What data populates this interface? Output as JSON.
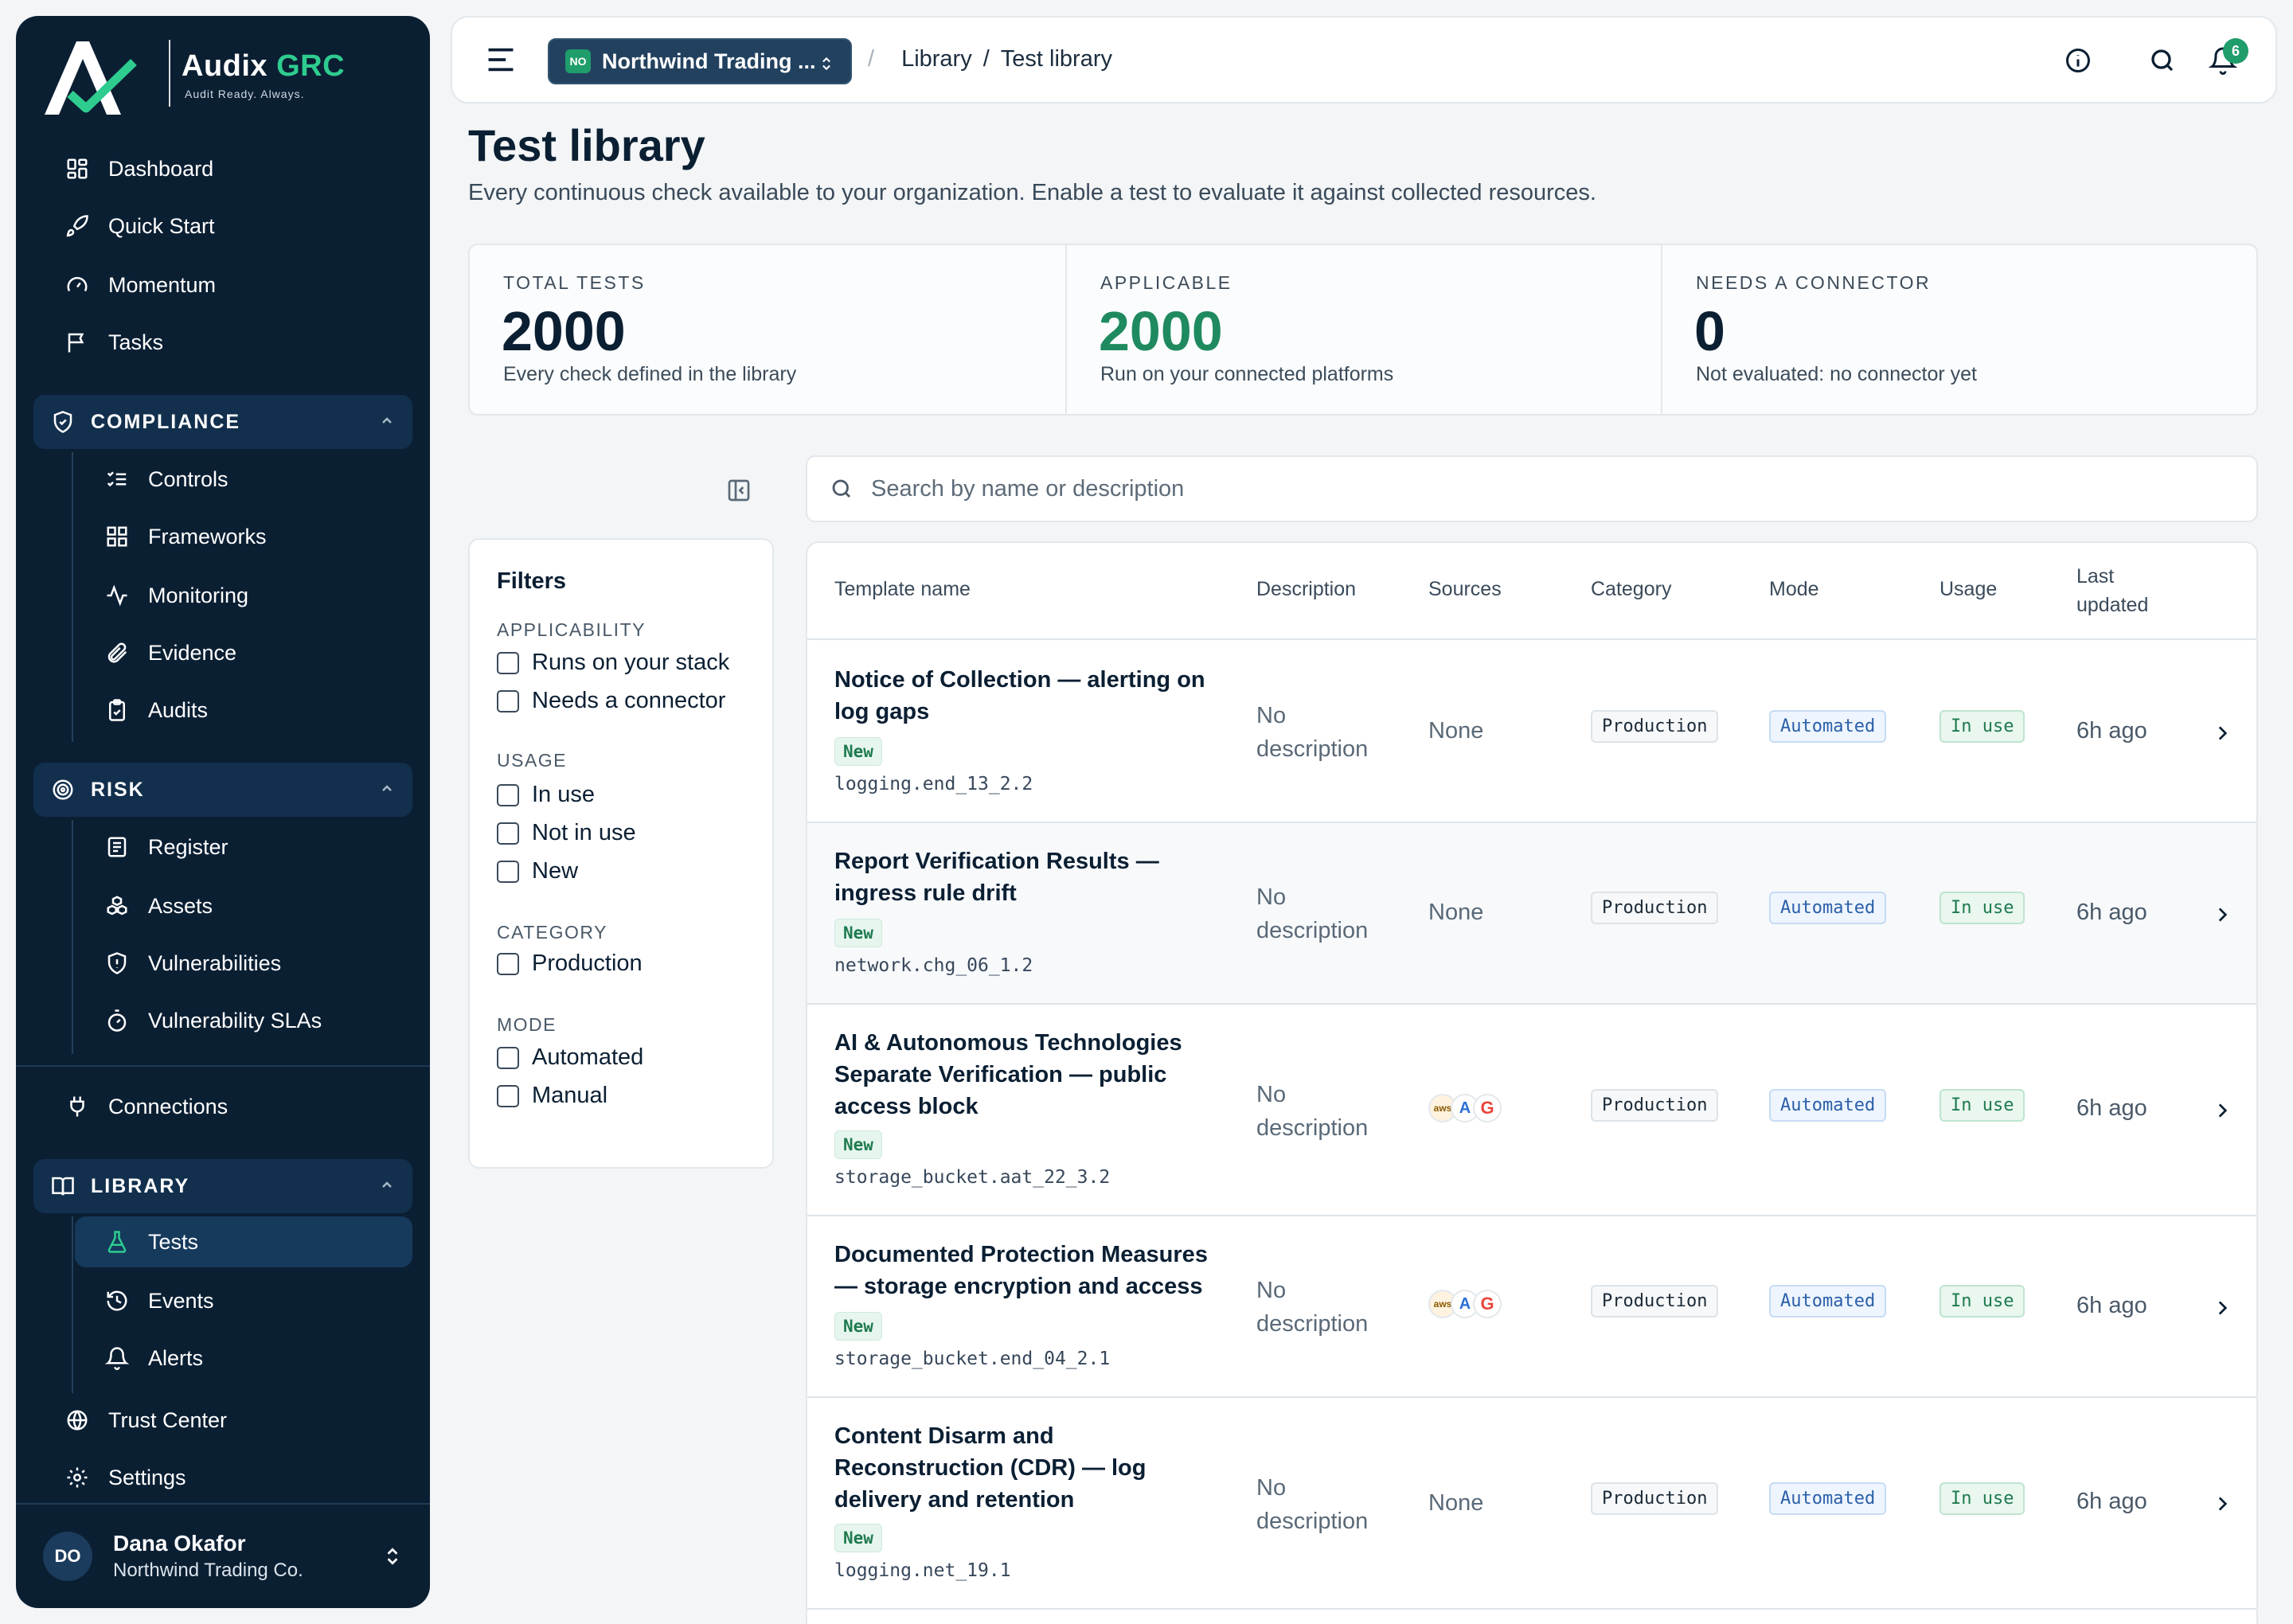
{
  "brand": {
    "name_main": "Audix",
    "name_accent": "GRC",
    "tagline": "Audit Ready. Always."
  },
  "sidebar": {
    "top_items": [
      {
        "label": "Dashboard",
        "icon": "dashboard-icon"
      },
      {
        "label": "Quick Start",
        "icon": "rocket-icon"
      },
      {
        "label": "Momentum",
        "icon": "gauge-icon"
      },
      {
        "label": "Tasks",
        "icon": "flag-icon"
      }
    ],
    "compliance": {
      "label": "COMPLIANCE",
      "items": [
        {
          "label": "Controls",
          "icon": "list-check-icon"
        },
        {
          "label": "Frameworks",
          "icon": "grid-icon"
        },
        {
          "label": "Monitoring",
          "icon": "activity-icon"
        },
        {
          "label": "Evidence",
          "icon": "paperclip-icon"
        },
        {
          "label": "Audits",
          "icon": "clipboard-icon"
        }
      ]
    },
    "risk": {
      "label": "RISK",
      "items": [
        {
          "label": "Register",
          "icon": "register-icon"
        },
        {
          "label": "Assets",
          "icon": "boxes-icon"
        },
        {
          "label": "Vulnerabilities",
          "icon": "shield-alert-icon"
        },
        {
          "label": "Vulnerability SLAs",
          "icon": "timer-icon"
        }
      ]
    },
    "connections": {
      "label": "Connections",
      "icon": "plug-icon"
    },
    "library": {
      "label": "LIBRARY",
      "items": [
        {
          "label": "Tests",
          "icon": "flask-icon",
          "active": true
        },
        {
          "label": "Events",
          "icon": "history-icon"
        },
        {
          "label": "Alerts",
          "icon": "bell-icon"
        }
      ]
    },
    "bottom_items": [
      {
        "label": "Trust Center",
        "icon": "globe-icon"
      },
      {
        "label": "Settings",
        "icon": "gear-icon"
      }
    ],
    "user": {
      "initials": "DO",
      "name": "Dana Okafor",
      "org": "Northwind Trading Co."
    }
  },
  "topbar": {
    "org_badge": "NO",
    "org_name": "Northwind Trading ...",
    "breadcrumb": [
      "Library",
      "Test library"
    ],
    "notification_count": "6"
  },
  "page": {
    "title": "Test library",
    "subtitle": "Every continuous check available to your organization. Enable a test to evaluate it against collected resources."
  },
  "stats": [
    {
      "label": "TOTAL TESTS",
      "value": "2000",
      "desc": "Every check defined in the library"
    },
    {
      "label": "APPLICABLE",
      "value": "2000",
      "desc": "Run on your connected platforms"
    },
    {
      "label": "NEEDS A CONNECTOR",
      "value": "0",
      "desc": "Not evaluated: no connector yet"
    }
  ],
  "filters": {
    "title": "Filters",
    "groups": [
      {
        "label": "APPLICABILITY",
        "options": [
          "Runs on your stack",
          "Needs a connector"
        ]
      },
      {
        "label": "USAGE",
        "options": [
          "In use",
          "Not in use",
          "New"
        ]
      },
      {
        "label": "CATEGORY",
        "options": [
          "Production"
        ]
      },
      {
        "label": "MODE",
        "options": [
          "Automated",
          "Manual"
        ]
      }
    ]
  },
  "search": {
    "placeholder": "Search by name or description",
    "value": ""
  },
  "table": {
    "headers": {
      "name": "Template name",
      "description": "Description",
      "sources": "Sources",
      "category": "Category",
      "mode": "Mode",
      "usage": "Usage",
      "updated_1": "Last",
      "updated_2": "updated"
    },
    "rows": [
      {
        "name": "Notice of Collection — alerting on log gaps",
        "badge": "New",
        "id": "logging.end_13_2.2",
        "desc_1": "No",
        "desc_2": "description",
        "sources": "None",
        "category": "Production",
        "mode": "Automated",
        "usage": "In use",
        "updated": "6h ago"
      },
      {
        "name": "Report Verification Results — ingress rule drift",
        "badge": "New",
        "id": "network.chg_06_1.2",
        "desc_1": "No",
        "desc_2": "description",
        "sources": "None",
        "category": "Production",
        "mode": "Automated",
        "usage": "In use",
        "updated": "6h ago"
      },
      {
        "name": "AI & Autonomous Technologies Separate Verification — public access block",
        "badge": "New",
        "id": "storage_bucket.aat_22_3.2",
        "desc_1": "No",
        "desc_2": "description",
        "sources": "",
        "source_icons": [
          "aws-icon",
          "azure-icon",
          "gcp-icon"
        ],
        "source_labels": [
          "aws",
          "A",
          "G"
        ],
        "category": "Production",
        "mode": "Automated",
        "usage": "In use",
        "updated": "6h ago"
      },
      {
        "name": "Documented Protection Measures — storage encryption and access",
        "badge": "New",
        "id": "storage_bucket.end_04_2.1",
        "desc_1": "No",
        "desc_2": "description",
        "sources": "",
        "source_icons": [
          "aws-icon",
          "azure-icon",
          "gcp-icon"
        ],
        "source_labels": [
          "aws",
          "A",
          "G"
        ],
        "category": "Production",
        "mode": "Automated",
        "usage": "In use",
        "updated": "6h ago"
      },
      {
        "name": "Content Disarm and Reconstruction (CDR) — log delivery and retention",
        "badge": "New",
        "id": "logging.net_19.1",
        "desc_1": "No",
        "desc_2": "description",
        "sources": "None",
        "category": "Production",
        "mode": "Automated",
        "usage": "In use",
        "updated": "6h ago"
      }
    ]
  },
  "colors": {
    "sidebar_bg": "#0b1f33",
    "accent_green": "#1f9d6b",
    "active_item": "#163a5c"
  }
}
